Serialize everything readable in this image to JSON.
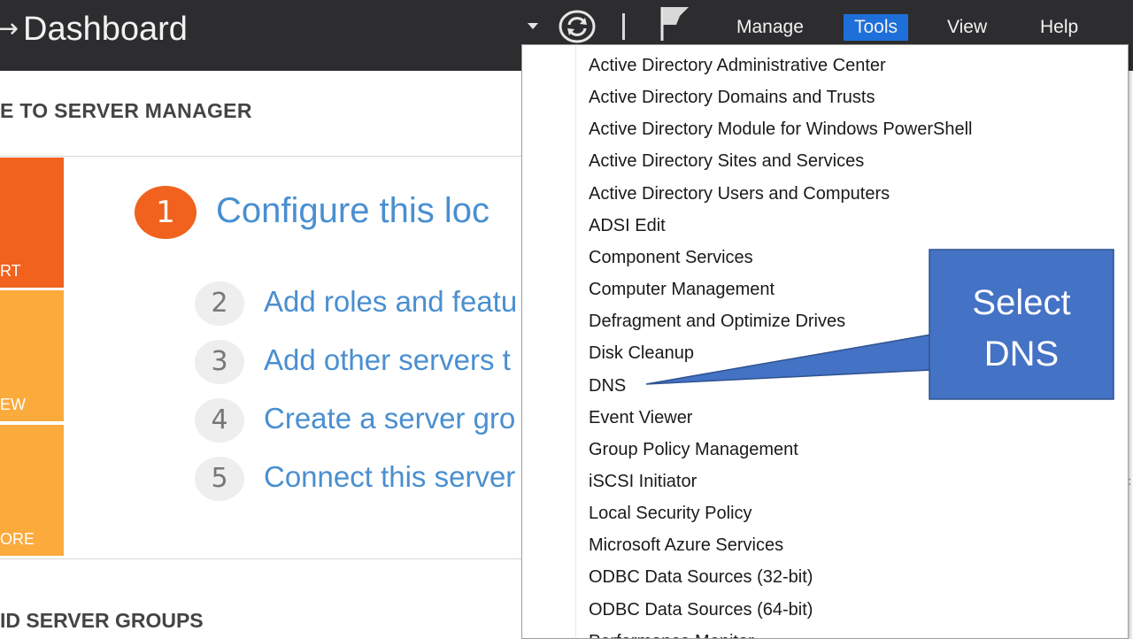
{
  "header": {
    "back_arrow_glyph": "→",
    "title": "Dashboard",
    "menu": {
      "manage": "Manage",
      "tools": "Tools",
      "view": "View",
      "help": "Help"
    },
    "icons": [
      "dropdown-caret-icon",
      "refresh-icon",
      "flag-icon"
    ]
  },
  "welcome": {
    "heading": "E TO SERVER MANAGER",
    "tiles": [
      {
        "label": "RT",
        "color": "#f0621e"
      },
      {
        "label": "EW",
        "color": "#fbaa3c"
      },
      {
        "label": "ORE",
        "color": "#fbaa3c"
      }
    ],
    "steps": [
      {
        "number": "1",
        "text": "Configure this loc"
      },
      {
        "number": "2",
        "text": "Add roles and featu"
      },
      {
        "number": "3",
        "text": "Add other servers t"
      },
      {
        "number": "4",
        "text": "Create a server gro"
      },
      {
        "number": "5",
        "text": "Connect this server"
      }
    ],
    "groups_heading": "ID SERVER GROUPS"
  },
  "tools_menu": {
    "items": [
      "Active Directory Administrative Center",
      "Active Directory Domains and Trusts",
      "Active Directory Module for Windows PowerShell",
      "Active Directory Sites and Services",
      "Active Directory Users and Computers",
      "ADSI Edit",
      "Component Services",
      "Computer Management",
      "Defragment and Optimize Drives",
      "Disk Cleanup",
      "DNS",
      "Event Viewer",
      "Group Policy Management",
      "iSCSI Initiator",
      "Local Security Policy",
      "Microsoft Azure Services",
      "ODBC Data Sources (32-bit)",
      "ODBC Data Sources (64-bit)",
      "Performance Monitor"
    ],
    "highlighted_item": "DNS",
    "highlight_color": "#f6f62a"
  },
  "callout": {
    "line1": "Select",
    "line2": "DNS",
    "fill_color": "#4472c4",
    "border_color": "#2f528f"
  },
  "colors": {
    "header_bg": "#2d2d30",
    "active_menu": "#1e6fd9",
    "link_blue": "#4a8fd0",
    "orange": "#f0621e",
    "amber": "#fbaa3c"
  }
}
